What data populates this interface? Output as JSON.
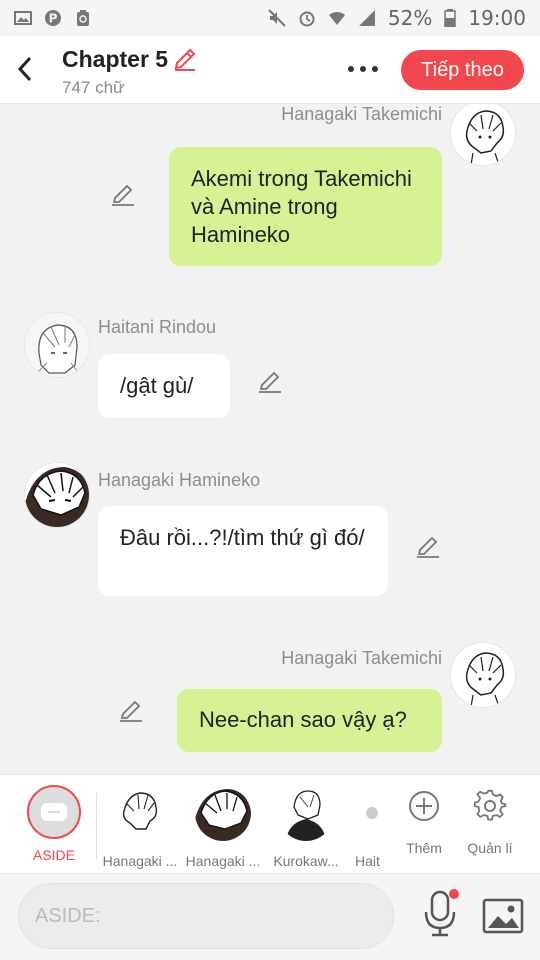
{
  "status_bar": {
    "battery": "52%",
    "time": "19:00",
    "icons": [
      "image-icon",
      "pinterest-icon",
      "recycle-icon",
      "mute-icon",
      "alarm-icon",
      "wifi-icon",
      "signal-icon",
      "battery-icon"
    ]
  },
  "header": {
    "title": "Chapter 5",
    "word_count": "747 chữ",
    "next_label": "Tiếp theo",
    "accent": "#f2474c"
  },
  "messages": [
    {
      "speaker": "Hanagaki Takemichi",
      "side": "right",
      "text": "Akemi trong Takemichi và Amine trong Hamineko",
      "bubble_color": "#d6f295"
    },
    {
      "speaker": "Haitani Rindou",
      "side": "left",
      "text": "/gật gù/",
      "bubble_color": "#ffffff"
    },
    {
      "speaker": "Hanagaki Hamineko",
      "side": "left",
      "text": "Đâu rồi...?!/tìm thứ gì đó/",
      "bubble_color": "#ffffff"
    },
    {
      "speaker": "Hanagaki Takemichi",
      "side": "right",
      "text": "Nee-chan sao vậy ạ?",
      "bubble_color": "#d6f295"
    }
  ],
  "character_bar": {
    "aside_label": "ASIDE",
    "characters": [
      "Hanagaki ...",
      "Hanagaki ...",
      "Kurokaw...",
      "Hait"
    ],
    "add_label": "Thêm",
    "manage_label": "Quản lí"
  },
  "composer": {
    "placeholder": "ASIDE:"
  }
}
